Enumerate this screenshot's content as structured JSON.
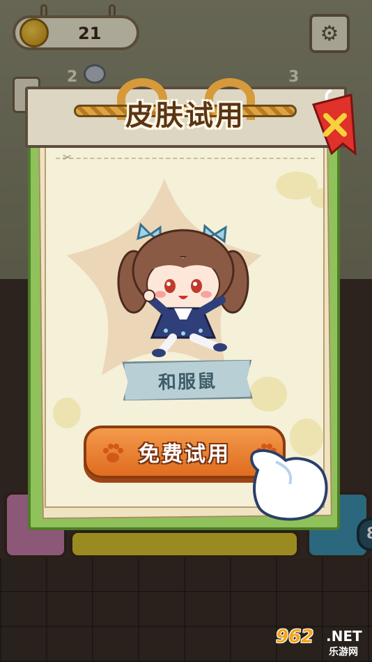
{
  "hud": {
    "coins": "21",
    "coin_icon": "coin-icon",
    "settings_icon": "gear-icon",
    "level_left": "2",
    "level_right": "3"
  },
  "popup": {
    "title": "皮肤试用",
    "close_icon": "close-x-icon",
    "skin_name": "和服鼠",
    "trial_button_label": "免费试用"
  },
  "side": {
    "badge_value": "8"
  },
  "watermark": {
    "brand_number": "962",
    "brand_suffix": ".NET",
    "brand_text": "乐游网"
  },
  "colors": {
    "panel_green": "#8fc25a",
    "button_orange": "#e9782a",
    "title_brown": "#5a3514",
    "name_label_blue": "#b9cfd6",
    "ribbon_red": "#e0312b"
  }
}
